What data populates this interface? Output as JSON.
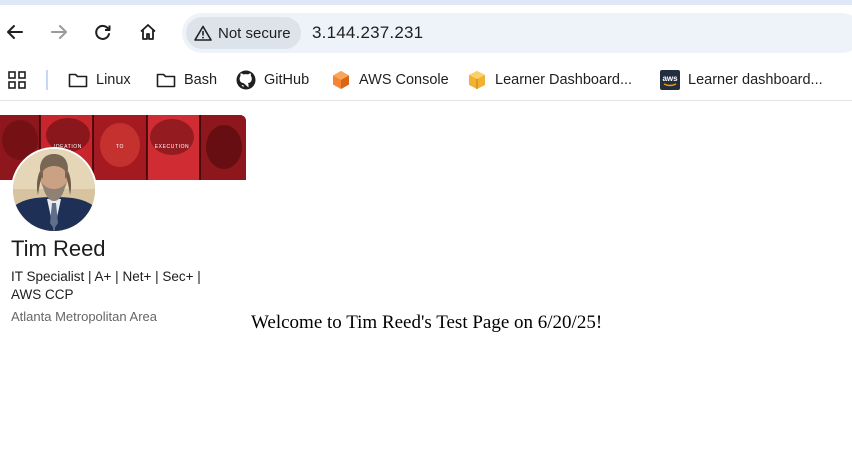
{
  "browser": {
    "security_chip": "Not secure",
    "url": "3.144.237.231",
    "icons": [
      "back-icon",
      "forward-icon",
      "reload-icon",
      "home-icon",
      "warning-icon"
    ]
  },
  "bookmarks": [
    {
      "label": "Linux",
      "icon": "folder-icon"
    },
    {
      "label": "Bash",
      "icon": "folder-icon"
    },
    {
      "label": "GitHub",
      "icon": "github-icon"
    },
    {
      "label": "AWS Console",
      "icon": "aws-cube-icon"
    },
    {
      "label": "Learner Dashboard...",
      "icon": "aws-box-icon"
    },
    {
      "label": "Learner dashboard...",
      "icon": "aws-logo-icon"
    }
  ],
  "profile": {
    "banner_text": [
      "IDEATION",
      "TO",
      "EXECUTION"
    ],
    "name": "Tim Reed",
    "headline": "IT Specialist | A+ | Net+ | Sec+ | AWS CCP",
    "location": "Atlanta Metropolitan Area"
  },
  "page": {
    "welcome": "Welcome to Tim Reed's Test Page on 6/20/25!"
  },
  "colors": {
    "banner_red": "#c8262c",
    "banner_dark": "#7a1418",
    "omnibox_bg": "#eef2f9",
    "chip_bg": "#dde3ea"
  }
}
